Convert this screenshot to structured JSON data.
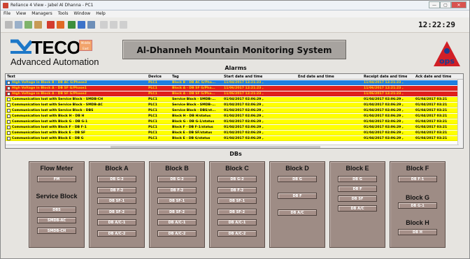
{
  "window": {
    "title": "Reliance 4 View - Jabel Al Dhanna - PC1",
    "buttons": [
      "—",
      "▢",
      "✕"
    ]
  },
  "menu": [
    "File",
    "View",
    "Managers",
    "Tools",
    "Window",
    "Help"
  ],
  "toolbar": {
    "clock": "12:22:29"
  },
  "logo": {
    "brand": "TECO",
    "subtitle": "Advanced Automation",
    "emblem_text": "Middle East"
  },
  "system_title": "Al-Dhanneh Mountain Monitoring System",
  "ops_logo": "ops",
  "alarms": {
    "heading": "Alarms",
    "columns": [
      "Text",
      "Device",
      "Tag",
      "Start date and time",
      "End date and time",
      "Receipt date and time",
      "Ack date and time"
    ],
    "rows": [
      {
        "text": "High Voltage in Block B - DB AC G/Phase3",
        "device": "PLC1",
        "tag": "Block B - DB AC G/Pha...",
        "start": "11/04/2017 12:21:23 ,",
        "end": "",
        "receipt": "11/04/2017 12:21:23 ,",
        "ack": "",
        "bg": "#1f7fe0",
        "fg": "#ffd100"
      },
      {
        "text": "High Voltage in Block A - DB SF G/Phase1",
        "device": "PLC1",
        "tag": "Block A - DB SF G/Pha...",
        "start": "11/06/2017 12:21:23 ,",
        "end": "",
        "receipt": "11/06/2017 12:21:23 ,",
        "ack": "",
        "bg": "#e0201c",
        "fg": "#ffd100"
      },
      {
        "text": "High Voltage in Block A - DB SF G/Phase2",
        "device": "PLC1",
        "tag": "Block A - DB SF G/Pha...",
        "start": "11/06/2017 12:21:23 ,",
        "end": "",
        "receipt": "11/06/2017 12:21:23 ,",
        "ack": "",
        "bg": "#e0201c",
        "fg": "#ffd100"
      },
      {
        "text": "Communication lost with Service Block - SMDB-CH",
        "device": "PLC1",
        "tag": "Service Block - SMDB-...",
        "start": "01/04/2017 02:06:29 ,",
        "end": "",
        "receipt": "01/04/2017 02:06:29 ,",
        "ack": "01/04/2017 03:21",
        "bg": "#ffff00",
        "fg": "#000"
      },
      {
        "text": "Communication lost with Service Block - SMDB-AC",
        "device": "PLC1",
        "tag": "Service Block - SMDB-...",
        "start": "01/04/2017 02:06:29 ,",
        "end": "",
        "receipt": "01/04/2017 02:06:29 ,",
        "ack": "01/04/2017 03:21",
        "bg": "#ffff00",
        "fg": "#000"
      },
      {
        "text": "Communication lost with Service Block - DBS",
        "device": "PLC1",
        "tag": "Service Block - DBS/st...",
        "start": "01/04/2017 02:06:29 ,",
        "end": "",
        "receipt": "01/04/2017 02:06:29 ,",
        "ack": "01/04/2017 03:21",
        "bg": "#ffff00",
        "fg": "#000"
      },
      {
        "text": "Communication lost with Block H - DB H",
        "device": "PLC1",
        "tag": "Block H - DB H/status",
        "start": "01/04/2017 02:06:29 ,",
        "end": "",
        "receipt": "01/04/2017 02:06:29 ,",
        "ack": "01/04/2017 03:21",
        "bg": "#ffff00",
        "fg": "#000"
      },
      {
        "text": "Communication lost with Block G - DB G-1",
        "device": "PLC1",
        "tag": "Block G - DB G-1/status",
        "start": "01/04/2017 02:06:29 ,",
        "end": "",
        "receipt": "01/04/2017 02:06:29 ,",
        "ack": "01/04/2017 03:21",
        "bg": "#ffff00",
        "fg": "#000"
      },
      {
        "text": "Communication lost with Block F - DB F-1",
        "device": "PLC1",
        "tag": "Block F - DB F-1/status",
        "start": "01/04/2017 02:06:29 ,",
        "end": "",
        "receipt": "01/04/2017 02:06:29 ,",
        "ack": "01/04/2017 03:21",
        "bg": "#ffff00",
        "fg": "#000"
      },
      {
        "text": "Communication lost with Block E - DB SF",
        "device": "PLC1",
        "tag": "Block E - DB SF/status",
        "start": "01/04/2017 02:06:29 ,",
        "end": "",
        "receipt": "01/04/2017 02:06:29 ,",
        "ack": "01/04/2017 03:21",
        "bg": "#ffff00",
        "fg": "#000"
      },
      {
        "text": "Communication lost with Block E - DB G",
        "device": "PLC1",
        "tag": "Block E - DB G/status",
        "start": "01/04/2017 02:06:29 ,",
        "end": "",
        "receipt": "01/04/2017 02:06:29 ,",
        "ack": "01/04/2017 03:21",
        "bg": "#ffff00",
        "fg": "#000"
      }
    ]
  },
  "dbs": {
    "heading": "DBs",
    "blocks": [
      {
        "title": "Flow Meter",
        "buttons": [
          "FM"
        ],
        "sub_title": "Service Block",
        "sub_buttons": [
          "DBS",
          "SMDB-AC",
          "SMDB-CH"
        ]
      },
      {
        "title": "Block A",
        "buttons": [
          "DB G-2",
          "DB F-2",
          "DB SF-1",
          "DB SF-2",
          "DB A/C-1",
          "DB A/C-2"
        ]
      },
      {
        "title": "Block B",
        "buttons": [
          "DB G-2",
          "DB F-2",
          "DB SF-1",
          "DB SF-2",
          "DB A/C-1",
          "DB A/C-2"
        ]
      },
      {
        "title": "Block C",
        "buttons": [
          "DB G-2",
          "DB F-2",
          "DB SF-1",
          "DB SF-2",
          "DB A/C-1",
          "DB A/C-2"
        ]
      },
      {
        "title": "Block D",
        "buttons": [
          "DB G",
          "DB F",
          "DB A/C"
        ]
      },
      {
        "title": "Block E",
        "buttons": [
          "DB G",
          "DB F",
          "DB SF",
          "DB A/C"
        ]
      },
      {
        "title": "Block F",
        "buttons": [
          "DB F-1"
        ],
        "sub_title": "Block G",
        "sub_buttons": [
          "DB G-1"
        ],
        "sub_title2": "Block H",
        "sub_buttons2": [
          "DB H"
        ]
      }
    ]
  }
}
